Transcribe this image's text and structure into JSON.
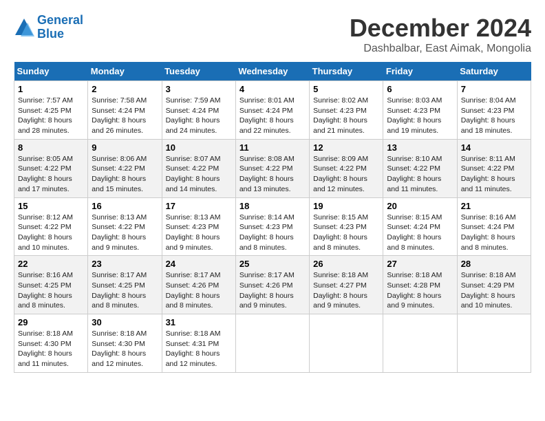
{
  "header": {
    "logo_line1": "General",
    "logo_line2": "Blue",
    "month_title": "December 2024",
    "location": "Dashbalbar, East Aimak, Mongolia"
  },
  "days_of_week": [
    "Sunday",
    "Monday",
    "Tuesday",
    "Wednesday",
    "Thursday",
    "Friday",
    "Saturday"
  ],
  "weeks": [
    [
      {
        "day": 1,
        "sunrise": "7:57 AM",
        "sunset": "4:25 PM",
        "daylight": "8 hours and 28 minutes."
      },
      {
        "day": 2,
        "sunrise": "7:58 AM",
        "sunset": "4:24 PM",
        "daylight": "8 hours and 26 minutes."
      },
      {
        "day": 3,
        "sunrise": "7:59 AM",
        "sunset": "4:24 PM",
        "daylight": "8 hours and 24 minutes."
      },
      {
        "day": 4,
        "sunrise": "8:01 AM",
        "sunset": "4:24 PM",
        "daylight": "8 hours and 22 minutes."
      },
      {
        "day": 5,
        "sunrise": "8:02 AM",
        "sunset": "4:23 PM",
        "daylight": "8 hours and 21 minutes."
      },
      {
        "day": 6,
        "sunrise": "8:03 AM",
        "sunset": "4:23 PM",
        "daylight": "8 hours and 19 minutes."
      },
      {
        "day": 7,
        "sunrise": "8:04 AM",
        "sunset": "4:23 PM",
        "daylight": "8 hours and 18 minutes."
      }
    ],
    [
      {
        "day": 8,
        "sunrise": "8:05 AM",
        "sunset": "4:22 PM",
        "daylight": "8 hours and 17 minutes."
      },
      {
        "day": 9,
        "sunrise": "8:06 AM",
        "sunset": "4:22 PM",
        "daylight": "8 hours and 15 minutes."
      },
      {
        "day": 10,
        "sunrise": "8:07 AM",
        "sunset": "4:22 PM",
        "daylight": "8 hours and 14 minutes."
      },
      {
        "day": 11,
        "sunrise": "8:08 AM",
        "sunset": "4:22 PM",
        "daylight": "8 hours and 13 minutes."
      },
      {
        "day": 12,
        "sunrise": "8:09 AM",
        "sunset": "4:22 PM",
        "daylight": "8 hours and 12 minutes."
      },
      {
        "day": 13,
        "sunrise": "8:10 AM",
        "sunset": "4:22 PM",
        "daylight": "8 hours and 11 minutes."
      },
      {
        "day": 14,
        "sunrise": "8:11 AM",
        "sunset": "4:22 PM",
        "daylight": "8 hours and 11 minutes."
      }
    ],
    [
      {
        "day": 15,
        "sunrise": "8:12 AM",
        "sunset": "4:22 PM",
        "daylight": "8 hours and 10 minutes."
      },
      {
        "day": 16,
        "sunrise": "8:13 AM",
        "sunset": "4:22 PM",
        "daylight": "8 hours and 9 minutes."
      },
      {
        "day": 17,
        "sunrise": "8:13 AM",
        "sunset": "4:23 PM",
        "daylight": "8 hours and 9 minutes."
      },
      {
        "day": 18,
        "sunrise": "8:14 AM",
        "sunset": "4:23 PM",
        "daylight": "8 hours and 8 minutes."
      },
      {
        "day": 19,
        "sunrise": "8:15 AM",
        "sunset": "4:23 PM",
        "daylight": "8 hours and 8 minutes."
      },
      {
        "day": 20,
        "sunrise": "8:15 AM",
        "sunset": "4:24 PM",
        "daylight": "8 hours and 8 minutes."
      },
      {
        "day": 21,
        "sunrise": "8:16 AM",
        "sunset": "4:24 PM",
        "daylight": "8 hours and 8 minutes."
      }
    ],
    [
      {
        "day": 22,
        "sunrise": "8:16 AM",
        "sunset": "4:25 PM",
        "daylight": "8 hours and 8 minutes."
      },
      {
        "day": 23,
        "sunrise": "8:17 AM",
        "sunset": "4:25 PM",
        "daylight": "8 hours and 8 minutes."
      },
      {
        "day": 24,
        "sunrise": "8:17 AM",
        "sunset": "4:26 PM",
        "daylight": "8 hours and 8 minutes."
      },
      {
        "day": 25,
        "sunrise": "8:17 AM",
        "sunset": "4:26 PM",
        "daylight": "8 hours and 9 minutes."
      },
      {
        "day": 26,
        "sunrise": "8:18 AM",
        "sunset": "4:27 PM",
        "daylight": "8 hours and 9 minutes."
      },
      {
        "day": 27,
        "sunrise": "8:18 AM",
        "sunset": "4:28 PM",
        "daylight": "8 hours and 9 minutes."
      },
      {
        "day": 28,
        "sunrise": "8:18 AM",
        "sunset": "4:29 PM",
        "daylight": "8 hours and 10 minutes."
      }
    ],
    [
      {
        "day": 29,
        "sunrise": "8:18 AM",
        "sunset": "4:30 PM",
        "daylight": "8 hours and 11 minutes."
      },
      {
        "day": 30,
        "sunrise": "8:18 AM",
        "sunset": "4:30 PM",
        "daylight": "8 hours and 12 minutes."
      },
      {
        "day": 31,
        "sunrise": "8:18 AM",
        "sunset": "4:31 PM",
        "daylight": "8 hours and 12 minutes."
      },
      null,
      null,
      null,
      null
    ]
  ]
}
